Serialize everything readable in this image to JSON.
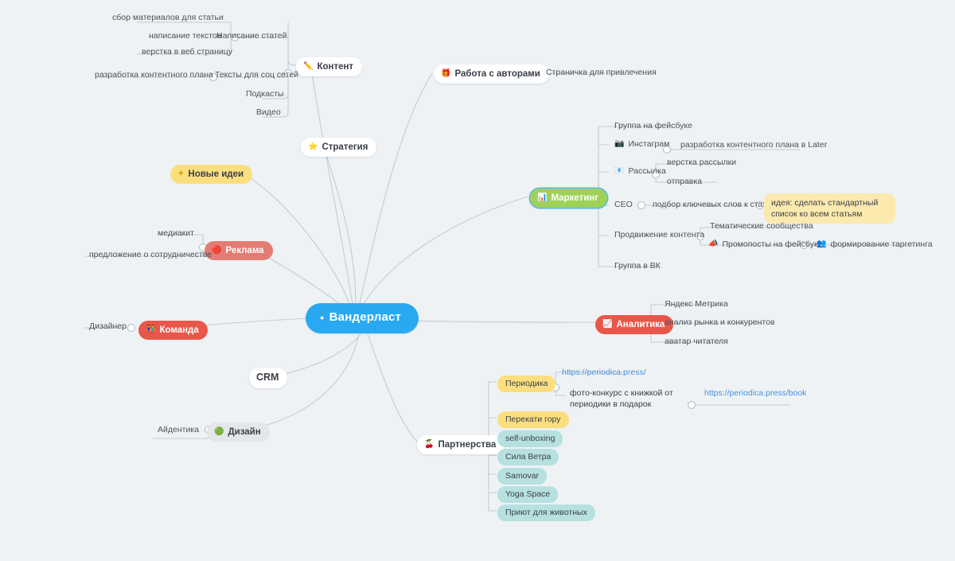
{
  "root": {
    "label": "Вандерласт",
    "icon": "bullet-icon",
    "color": "#29a9f2"
  },
  "branches": {
    "content": {
      "label": "Контент",
      "icon": "pencil-icon",
      "children": [
        {
          "label": "Написание статей",
          "children": [
            {
              "label": "сбор материалов для статьи"
            },
            {
              "label": "написание текстов"
            },
            {
              "label": "верстка в веб страницу"
            }
          ]
        },
        {
          "label": "Тексты для соц сетей",
          "children": [
            {
              "label": "разработка контентного плана"
            }
          ]
        },
        {
          "label": "Подкасты"
        },
        {
          "label": "Видео"
        }
      ]
    },
    "authors": {
      "label": "Работа с авторами",
      "icon": "gift-icon",
      "children": [
        {
          "label": "Страничка для привлечения"
        }
      ]
    },
    "strategy": {
      "label": "Стратегия",
      "icon": "star-icon"
    },
    "new_ideas": {
      "label": "Новые идеи",
      "icon": "sparkle-icon"
    },
    "marketing": {
      "label": "Маркетинг",
      "icon": "chart-icon",
      "children": [
        {
          "label": "Группа на фейсбуке"
        },
        {
          "label": "Инстаграм",
          "icon": "camera-icon",
          "children": [
            {
              "label": "разработка контентного плана в Later"
            }
          ]
        },
        {
          "label": "Рассылка",
          "icon": "mail-icon",
          "children": [
            {
              "label": "верстка рассылки"
            },
            {
              "label": "отправка"
            }
          ]
        },
        {
          "label": "CEO",
          "children": [
            {
              "label": "подбор ключевых слов к статье",
              "note": "идея: сделать стандартный список ко всем статьям"
            }
          ]
        },
        {
          "label": "Продвижение контента",
          "children": [
            {
              "label": "Тематические сообщества"
            },
            {
              "label": "Промопосты на фейсбуке",
              "icon": "megaphone-icon",
              "children": [
                {
                  "label": "формирование таргетинга",
                  "icon": "people-icon"
                }
              ]
            }
          ]
        },
        {
          "label": "Группа в ВК"
        }
      ]
    },
    "advertising": {
      "label": "Реклама",
      "icon": "circle-icon",
      "children": [
        {
          "label": "медиакит"
        },
        {
          "label": "предложение о сотрудничестве"
        }
      ]
    },
    "team": {
      "label": "Команда",
      "icon": "people-icon",
      "children": [
        {
          "label": "Дизайнер"
        }
      ]
    },
    "analytics": {
      "label": "Аналитика",
      "icon": "chart-icon",
      "children": [
        {
          "label": "Яндекс Метрика"
        },
        {
          "label": "анализ рынка и конкурентов"
        },
        {
          "label": "аватар читателя"
        }
      ]
    },
    "crm": {
      "label": "CRM"
    },
    "design": {
      "label": "Дизайн",
      "icon": "green-circle-icon",
      "children": [
        {
          "label": "Айдентика"
        }
      ]
    },
    "partnerships": {
      "label": "Партнерства",
      "icon": "cherry-icon",
      "children": [
        {
          "label": "Периодика",
          "links": [
            "https://periodica.press/"
          ],
          "children": [
            {
              "label": "фото-конкурс с книжкой от периодики в подарок",
              "links": [
                "https://periodica.press/book"
              ]
            }
          ]
        },
        {
          "label": "Перекати гору"
        },
        {
          "label": "self-unboxing"
        },
        {
          "label": "Сила Ветра"
        },
        {
          "label": "Samovar"
        },
        {
          "label": "Yoga Space"
        },
        {
          "label": "Приют для животных"
        }
      ]
    }
  }
}
